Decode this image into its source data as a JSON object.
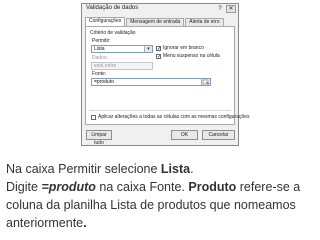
{
  "dialog": {
    "title": "Validação de dados",
    "help_glyph": "?",
    "close_glyph": "✕",
    "tabs": [
      {
        "label": "Configurações"
      },
      {
        "label": "Mensagem de entrada"
      },
      {
        "label": "Alerta de erro"
      }
    ],
    "group_label": "Critério de validação",
    "permitir_label": "Permitir:",
    "permitir_value": "Lista",
    "ignorar_branco": {
      "label": "Ignorar em branco",
      "checked": true
    },
    "dados_label": "Dados:",
    "dados_value": "está entre",
    "menu_suspenso": {
      "label": "Menu suspenso na célula",
      "checked": true
    },
    "fonte_label": "Fonte:",
    "fonte_value": "=produto",
    "aplicar": {
      "label": "Aplicar alterações a todas as células com as mesmas configurações",
      "checked": false
    },
    "limpar_label": "Limpar tudo",
    "ok_label": "OK",
    "cancel_label": "Cancelar"
  },
  "instructions": {
    "line1_pre": "Na caixa Permitir selecione ",
    "line1_bold": "Lista",
    "line1_post": ".",
    "line2_pre": "Digite ",
    "line2_bolditalic": "=produto",
    "line2_mid": " na caixa Fonte. ",
    "line2_bold": "Produto",
    "line2_post": " refere-se a",
    "line3": "coluna da planilha Lista de produtos que nomeamos",
    "line4_pre": "anteriormente",
    "line4_post": "."
  }
}
